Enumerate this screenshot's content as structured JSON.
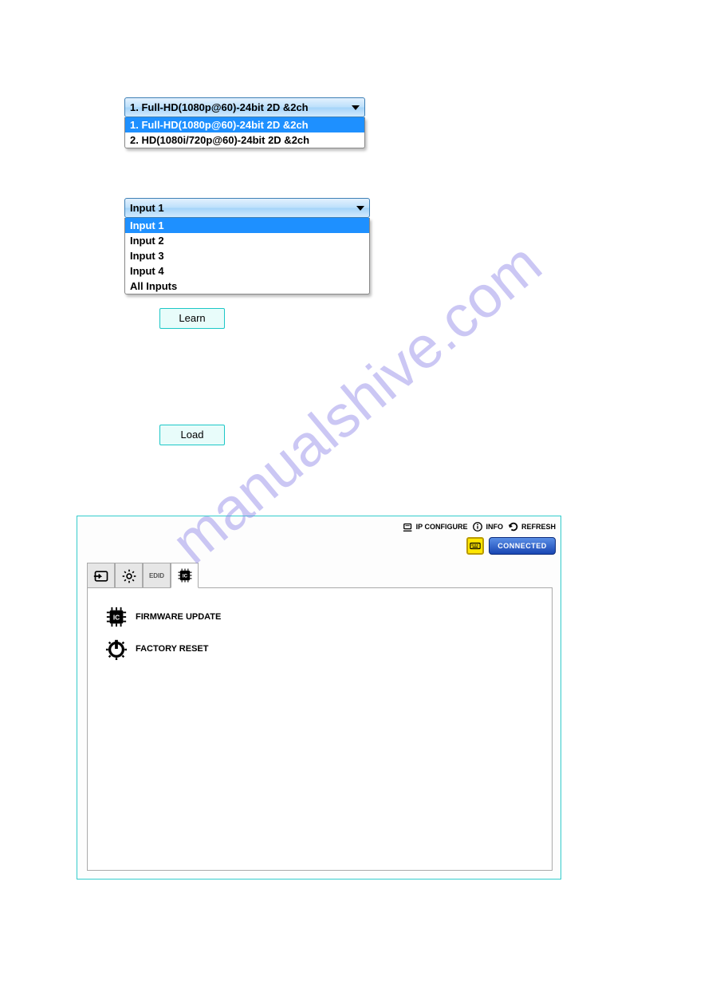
{
  "watermark": "manualshive.com",
  "dropdown1": {
    "selected": "1. Full-HD(1080p@60)-24bit 2D &2ch",
    "options": [
      "1. Full-HD(1080p@60)-24bit 2D &2ch",
      "2. HD(1080i/720p@60)-24bit 2D &2ch"
    ]
  },
  "dropdown2": {
    "selected": "Input 1",
    "options": [
      "Input 1",
      "Input 2",
      "Input 3",
      "Input 4",
      "All Inputs"
    ]
  },
  "buttons": {
    "learn": "Learn",
    "load": "Load"
  },
  "topbar": {
    "ip_configure": "IP CONFIGURE",
    "info": "INFO",
    "refresh": "REFRESH"
  },
  "connected_label": "CONNECTED",
  "tabs": {
    "edid": "EDID",
    "ic": "IC"
  },
  "system": {
    "firmware": "FIRMWARE UPDATE",
    "factory_reset": "FACTORY RESET"
  }
}
